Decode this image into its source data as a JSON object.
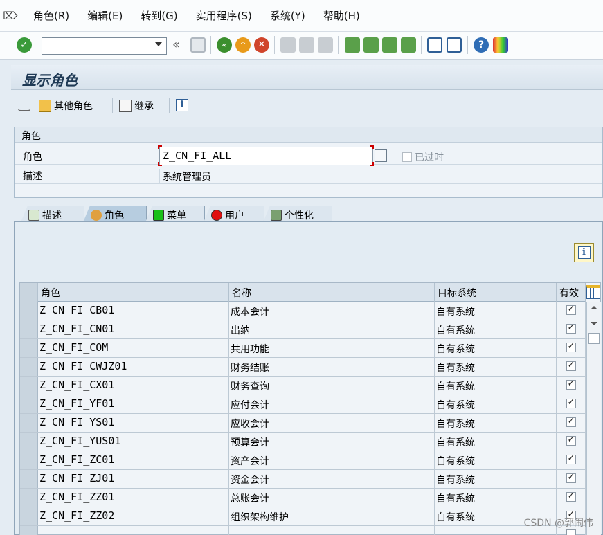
{
  "menu": {
    "items": [
      "角色(R)",
      "编辑(E)",
      "转到(G)",
      "实用程序(S)",
      "系统(Y)",
      "帮助(H)"
    ]
  },
  "toolbar": {
    "command_value": "",
    "prev_glyph": "«"
  },
  "page": {
    "title": "显示角色"
  },
  "app_toolbar": {
    "other_role_label": "其他角色",
    "inherit_label": "继承"
  },
  "role_group": {
    "heading": "角色",
    "role_label": "角色",
    "role_value": "Z_CN_FI_ALL",
    "desc_label": "描述",
    "desc_value": "系统管理员",
    "obsolete_label": "已过时",
    "obsolete_checked": false
  },
  "tabs": [
    {
      "label": "描述",
      "active": false
    },
    {
      "label": "角色",
      "active": true
    },
    {
      "label": "菜单",
      "active": false
    },
    {
      "label": "用户",
      "active": false
    },
    {
      "label": "个性化",
      "active": false
    }
  ],
  "table": {
    "columns": [
      "角色",
      "名称",
      "目标系统",
      "有效"
    ],
    "rows": [
      {
        "role": "Z_CN_FI_CB01",
        "name": "成本会计",
        "target": "自有系统",
        "valid": true
      },
      {
        "role": "Z_CN_FI_CN01",
        "name": "出纳",
        "target": "自有系统",
        "valid": true
      },
      {
        "role": "Z_CN_FI_COM",
        "name": "共用功能",
        "target": "自有系统",
        "valid": true
      },
      {
        "role": "Z_CN_FI_CWJZ01",
        "name": "财务结账",
        "target": "自有系统",
        "valid": true
      },
      {
        "role": "Z_CN_FI_CX01",
        "name": "财务查询",
        "target": "自有系统",
        "valid": true
      },
      {
        "role": "Z_CN_FI_YF01",
        "name": "应付会计",
        "target": "自有系统",
        "valid": true
      },
      {
        "role": "Z_CN_FI_YS01",
        "name": "应收会计",
        "target": "自有系统",
        "valid": true
      },
      {
        "role": "Z_CN_FI_YUS01",
        "name": "预算会计",
        "target": "自有系统",
        "valid": true
      },
      {
        "role": "Z_CN_FI_ZC01",
        "name": "资产会计",
        "target": "自有系统",
        "valid": true
      },
      {
        "role": "Z_CN_FI_ZJ01",
        "name": "资金会计",
        "target": "自有系统",
        "valid": true
      },
      {
        "role": "Z_CN_FI_ZZ01",
        "name": "总账会计",
        "target": "自有系统",
        "valid": true
      },
      {
        "role": "Z_CN_FI_ZZ02",
        "name": "组织架构维护",
        "target": "自有系统",
        "valid": true
      }
    ]
  },
  "watermark": "CSDN @郭闹伟",
  "colors": {
    "accent_green": "#3a9a3a",
    "menu_tab_green": "#19c019",
    "user_tab_red": "#e01010",
    "title_color": "#1f3a55"
  }
}
